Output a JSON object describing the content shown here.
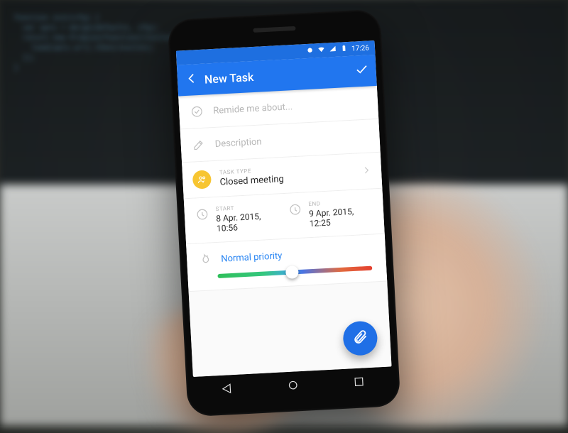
{
  "status": {
    "time": "17:26"
  },
  "appbar": {
    "title": "New Task"
  },
  "fields": {
    "reminder_placeholder": "Remide me about...",
    "description_placeholder": "Description"
  },
  "task_type": {
    "label": "TASK TYPE",
    "value": "Closed meeting"
  },
  "start": {
    "label": "START",
    "value": "8 Apr. 2015, 10:56"
  },
  "end": {
    "label": "END",
    "value": "9 Apr. 2015,  12:25"
  },
  "priority": {
    "label": "Normal priority",
    "position_percent": 48
  }
}
